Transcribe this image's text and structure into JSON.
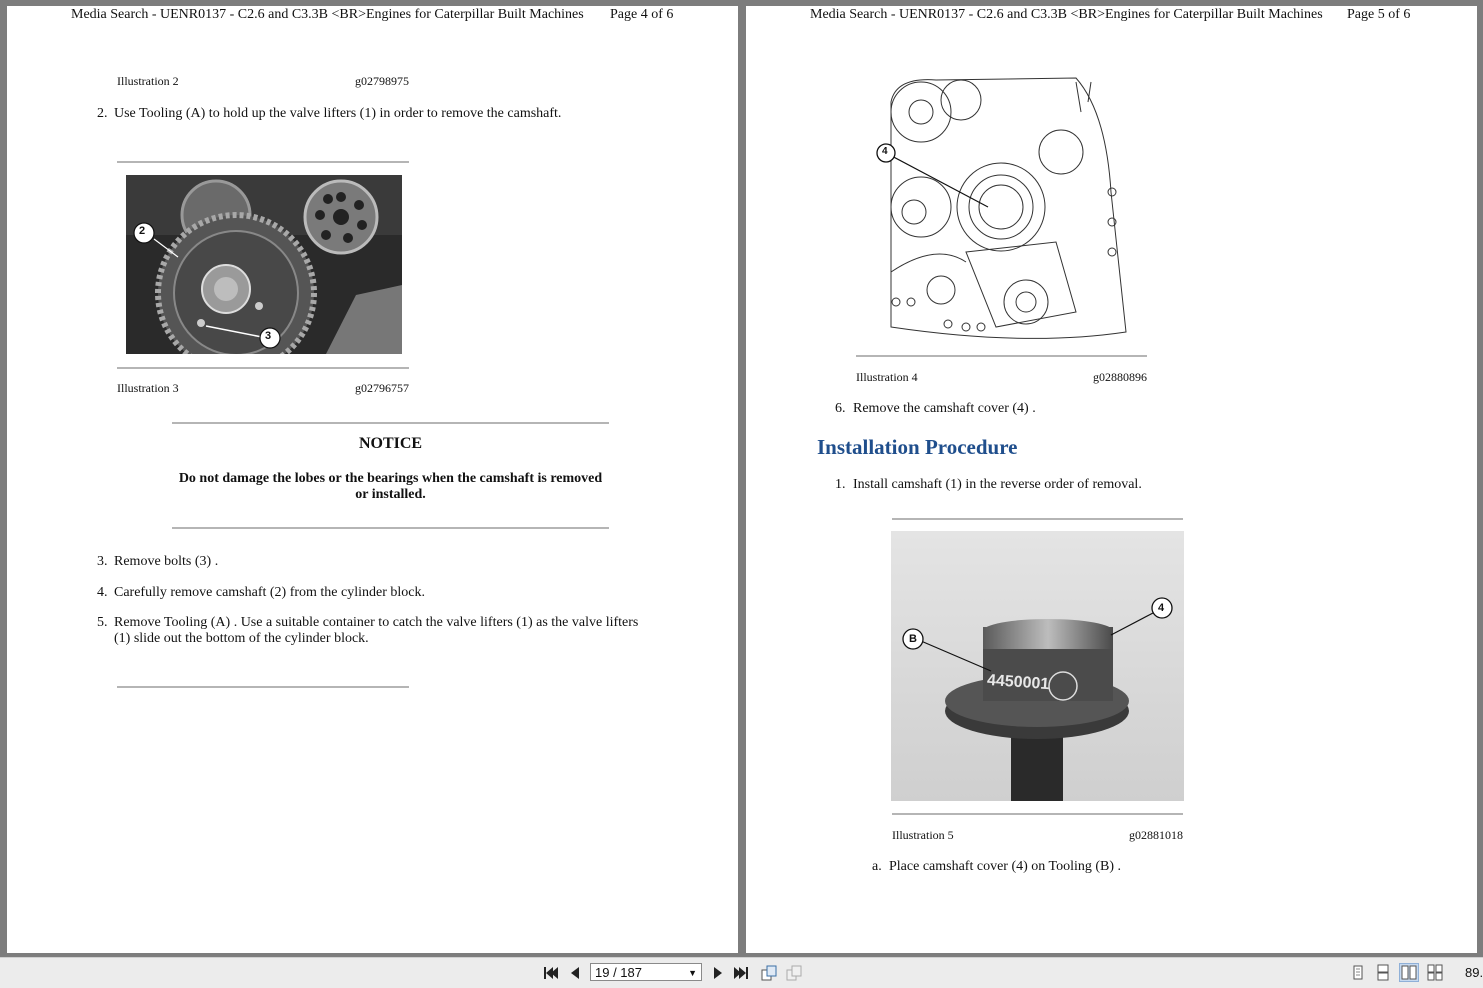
{
  "left_page": {
    "header": "Media Search - UENR0137 - C2.6 and C3.3B <BR>Engines for Caterpillar Built Machines",
    "page_label": "Page 4 of 6",
    "illustration2": {
      "label": "Illustration 2",
      "code": "g02798975"
    },
    "step2": {
      "num": "2.",
      "text": "Use Tooling (A) to hold up the valve lifters (1) in order to remove the camshaft."
    },
    "illustration3": {
      "label": "Illustration 3",
      "code": "g02796757",
      "callouts": [
        "2",
        "3"
      ]
    },
    "notice": {
      "title": "NOTICE",
      "text": "Do not damage the lobes or the bearings when the camshaft is removed or installed."
    },
    "steps": [
      {
        "num": "3.",
        "text": "Remove bolts (3) ."
      },
      {
        "num": "4.",
        "text": "Carefully remove camshaft (2) from the cylinder block."
      },
      {
        "num": "5.",
        "line1": "Remove Tooling (A) . Use a suitable container to catch the valve lifters (1) as the valve lifters",
        "line2": "(1) slide out the bottom of the cylinder block."
      }
    ]
  },
  "right_page": {
    "header": "Media Search - UENR0137 - C2.6 and C3.3B <BR>Engines for Caterpillar Built Machines",
    "page_label": "Page 5 of 6",
    "illustration4": {
      "label": "Illustration 4",
      "code": "g02880896",
      "callouts": [
        "4"
      ]
    },
    "step6": {
      "num": "6.",
      "text": "Remove the camshaft cover (4) ."
    },
    "section_heading": "Installation Procedure",
    "install_step1": {
      "num": "1.",
      "text": "Install camshaft (1) in the reverse order of removal."
    },
    "illustration5": {
      "label": "Illustration 5",
      "code": "g02881018",
      "callouts": [
        "4",
        "B"
      ],
      "part_marking": "4450001"
    },
    "substep_a": {
      "num": "a.",
      "text": "Place camshaft cover (4) on Tooling (B) ."
    }
  },
  "statusbar": {
    "page_indicator": "19 / 187",
    "zoom": "89.",
    "icons": [
      "first-page-icon",
      "previous-page-icon",
      "next-page-icon",
      "last-page-icon",
      "single-page-view-icon",
      "continuous-view-icon",
      "facing-pages-view-icon",
      "continuous-facing-view-icon"
    ]
  }
}
